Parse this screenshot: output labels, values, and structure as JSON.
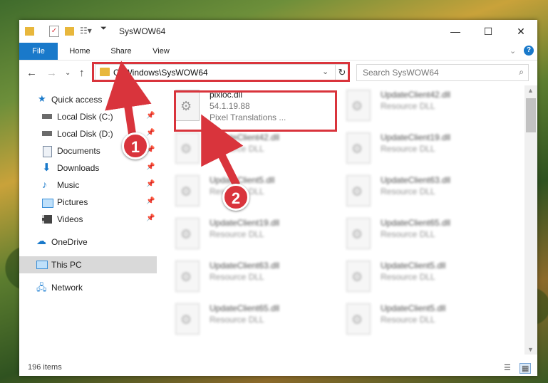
{
  "window": {
    "title": "SysWOW64",
    "minimize": "—",
    "maximize": "☐",
    "close": "✕"
  },
  "ribbon": {
    "tabs": [
      "File",
      "Home",
      "Share",
      "View"
    ]
  },
  "nav": {
    "address": "C:\\Windows\\SysWOW64",
    "search_placeholder": "Search SysWOW64"
  },
  "sidebar": {
    "items": [
      {
        "label": "Quick access",
        "icon": "star-icon",
        "color": "#1979ca"
      },
      {
        "label": "Local Disk (C:)",
        "icon": "drive-icon",
        "color": "#6b6b6b",
        "pinned": true
      },
      {
        "label": "Local Disk (D:)",
        "icon": "drive-icon",
        "color": "#6b6b6b",
        "pinned": true
      },
      {
        "label": "Documents",
        "icon": "documents-icon",
        "color": "#7a8aa0",
        "pinned": true
      },
      {
        "label": "Downloads",
        "icon": "download-icon",
        "color": "#1979ca",
        "pinned": true
      },
      {
        "label": "Music",
        "icon": "music-icon",
        "color": "#1979ca",
        "pinned": true
      },
      {
        "label": "Pictures",
        "icon": "pictures-icon",
        "color": "#3a8fd8",
        "pinned": true
      },
      {
        "label": "Videos",
        "icon": "videos-icon",
        "color": "#444",
        "pinned": true
      },
      {
        "label": "OneDrive",
        "icon": "cloud-icon",
        "color": "#1979ca"
      },
      {
        "label": "This PC",
        "icon": "computer-icon",
        "color": "#3a8fd8",
        "selected": true
      },
      {
        "label": "Network",
        "icon": "network-icon",
        "color": "#3a8fd8"
      }
    ]
  },
  "files": {
    "highlighted": {
      "name": "pixloc.dll",
      "version": "54.1.19.88",
      "company": "Pixel Translations ..."
    },
    "blurred": [
      {
        "name": "UpdateClient42.dll",
        "type": "Resource DLL"
      },
      {
        "name": "UpdateClient42.dll",
        "type": "Resource DLL"
      },
      {
        "name": "UpdateClient19.dll",
        "type": "Resource DLL"
      },
      {
        "name": "UpdateClient5.dll",
        "type": "Resource DLL"
      },
      {
        "name": "UpdateClient63.dll",
        "type": "Resource DLL"
      },
      {
        "name": "UpdateClient19.dll",
        "type": "Resource DLL"
      },
      {
        "name": "UpdateClient65.dll",
        "type": "Resource DLL"
      },
      {
        "name": "UpdateClient63.dll",
        "type": "Resource DLL"
      },
      {
        "name": "UpdateClient5.dll",
        "type": "Resource DLL"
      },
      {
        "name": "UpdateClient65.dll",
        "type": "Resource DLL"
      },
      {
        "name": "UpdateClient5.dll",
        "type": "Resource DLL"
      }
    ]
  },
  "status": {
    "item_count": "196 items"
  },
  "callouts": [
    "1",
    "2"
  ],
  "colors": {
    "accent": "#1979ca",
    "highlight": "#d9343c"
  }
}
